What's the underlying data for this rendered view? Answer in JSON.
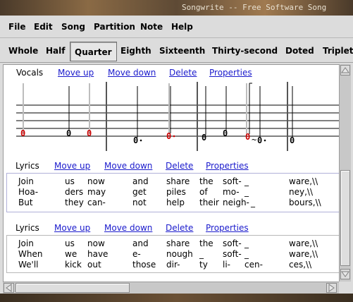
{
  "window": {
    "title": "Songwrite -- Free Software Song"
  },
  "menu": [
    "File",
    "Edit",
    "Song",
    "Partition",
    "Note",
    "Help"
  ],
  "durations": [
    "Whole",
    "Half",
    "Quarter",
    "Eighth",
    "Sixteenth",
    "Thirty-second",
    "Doted",
    "Triplet"
  ],
  "active_duration": "Quarter",
  "vocals": {
    "label": "Vocals",
    "actions": [
      "Move up",
      "Move down",
      "Delete",
      "Properties"
    ]
  },
  "lyrics": [
    {
      "label": "Lyrics",
      "actions": [
        "Move up",
        "Move down",
        "Delete",
        "Properties"
      ],
      "lines": [
        [
          "Join",
          "us",
          "now",
          "and",
          "share",
          "the",
          "soft-",
          "_",
          "ware,\\\\"
        ],
        [
          "Hoa-",
          "ders",
          "may",
          "get",
          "piles",
          "of",
          "mo-",
          "_",
          "ney,\\\\"
        ],
        [
          "But",
          "they",
          "can-",
          "not",
          "help",
          "their",
          "neigh-",
          "_",
          "bours,\\\\"
        ]
      ]
    },
    {
      "label": "Lyrics",
      "actions": [
        "Move up",
        "Move down",
        "Delete",
        "Properties"
      ],
      "lines": [
        [
          "Join",
          "us",
          "now",
          "and",
          "share",
          "the",
          "soft-",
          "_",
          "ware,\\\\"
        ],
        [
          "When",
          "we",
          "have",
          "e-",
          "nough",
          "_",
          "soft-",
          "_",
          "ware,\\\\"
        ],
        [
          "We'll",
          "kick",
          "out",
          "those",
          "dir-",
          "ty",
          "li-",
          "cen-",
          "ces,\\\\"
        ]
      ]
    }
  ],
  "colors": {
    "selected_note": "#cc0000",
    "link": "#1a1acc"
  }
}
